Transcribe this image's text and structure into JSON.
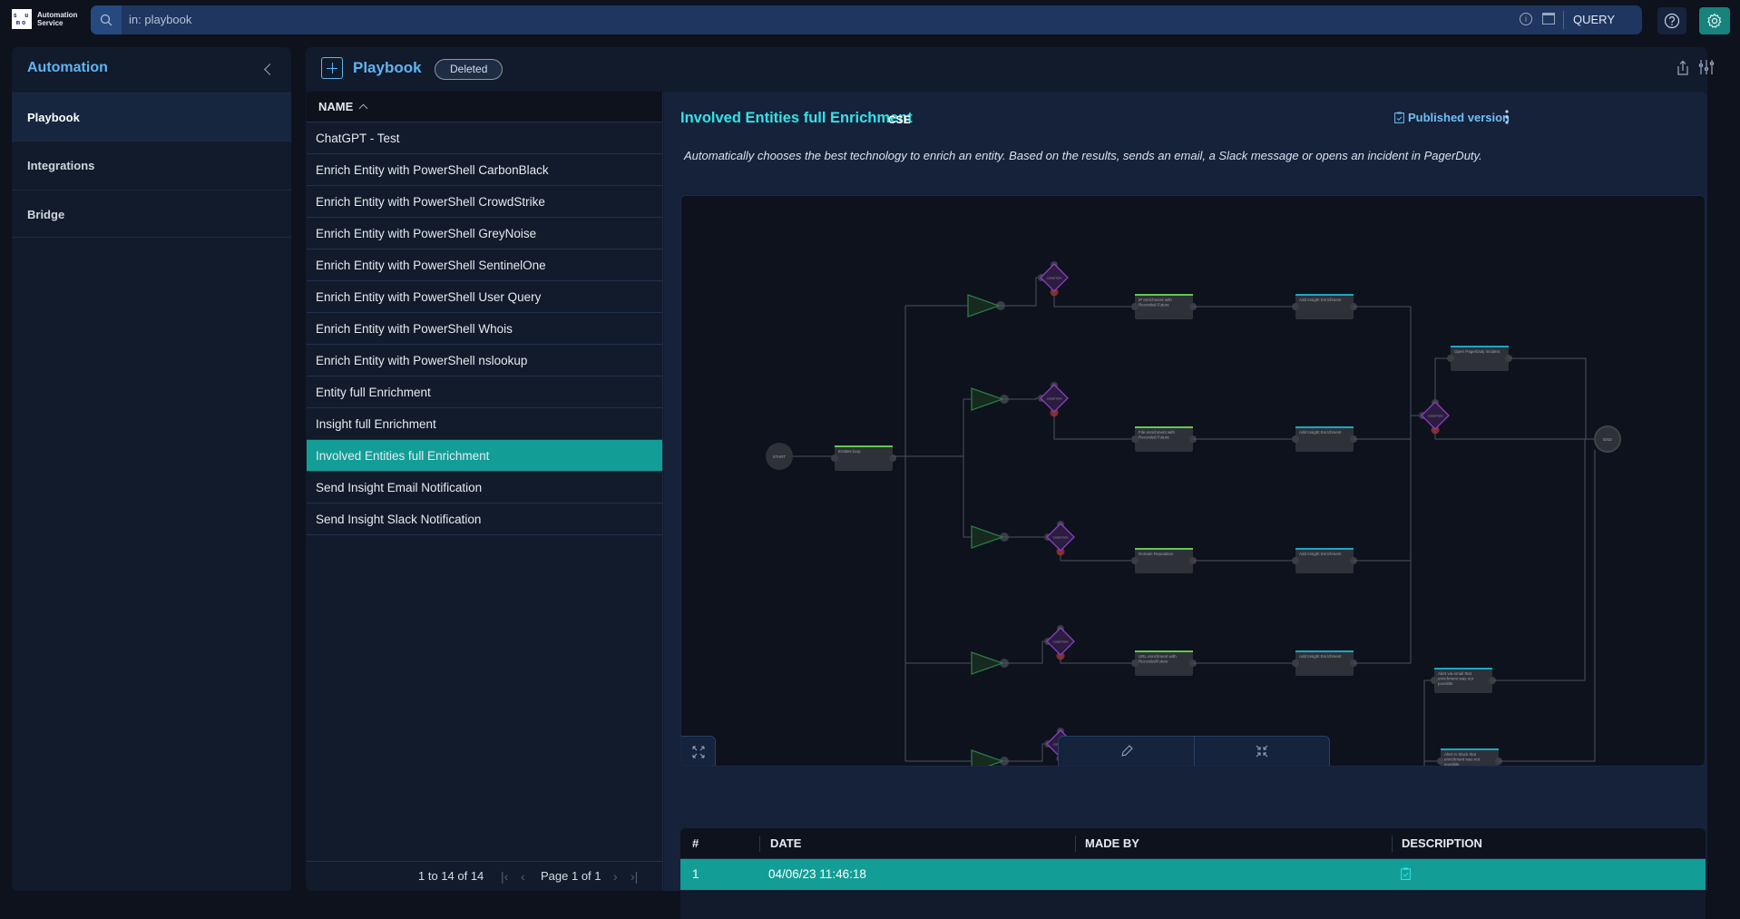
{
  "topbar": {
    "logo_text": "su mo",
    "app_name_line1": "Automation",
    "app_name_line2": "Service",
    "search_value": "in: playbook",
    "query_label": "QUERY"
  },
  "sidebar": {
    "title": "Automation",
    "items": [
      {
        "label": "Playbook",
        "active": true
      },
      {
        "label": "Integrations",
        "active": false
      },
      {
        "label": "Bridge",
        "active": false
      }
    ]
  },
  "main": {
    "title": "Playbook",
    "deleted_label": "Deleted",
    "list": {
      "column_header": "NAME",
      "sort": "ascending",
      "rows": [
        "ChatGPT - Test",
        "Enrich Entity with PowerShell CarbonBlack",
        "Enrich Entity with PowerShell CrowdStrike",
        "Enrich Entity with PowerShell GreyNoise",
        "Enrich Entity with PowerShell SentinelOne",
        "Enrich Entity with PowerShell User Query",
        "Enrich Entity with PowerShell Whois",
        "Enrich Entity with PowerShell nslookup",
        "Entity full Enrichment",
        "Insight full Enrichment",
        "Involved Entities full Enrichment",
        "Send Insight Email Notification",
        "Send Insight Slack Notification"
      ],
      "selected_index": 10,
      "pagination": {
        "count": "1 to 14 of 14",
        "page": "Page 1 of 1"
      }
    },
    "detail": {
      "title": "Involved Entities full Enrichment",
      "tag": "CSE",
      "published_label": "Published version",
      "description": "Automatically chooses the best technology to enrich an entity. Based on the results, sends an email, a Slack message or opens an incident in PagerDuty.",
      "flow": {
        "start_label": "START",
        "end_label": "END",
        "condition_label": "CONDITION",
        "loop_label": "Entities loop",
        "enrich_nodes": [
          "IP enrichment with Recorded Future",
          "File enrichment with Recorded Future",
          "Domain Reputation",
          "URL enrichment with RecordedFuture"
        ],
        "insight_label": "Add Insight Enrichment",
        "pagerduty_label": "Open PagerDuty incident",
        "email_alert_label": "Alert via email that enrichment was not possible",
        "slack_alert_label": "Alert in Slack that enrichment was not possible"
      },
      "history": {
        "columns": [
          "#",
          "DATE",
          "MADE BY",
          "DESCRIPTION"
        ],
        "rows": [
          {
            "num": "1",
            "date": "04/06/23 11:46:18",
            "made_by": "",
            "description_icon": "clipboard-check-icon"
          }
        ]
      }
    }
  },
  "colors": {
    "accent_teal": "#129e97",
    "title_cyan": "#33e3e8",
    "link_blue": "#5fb4f2",
    "condition_purple": "#8a3fbf",
    "trigger_green": "#2b7a45"
  }
}
